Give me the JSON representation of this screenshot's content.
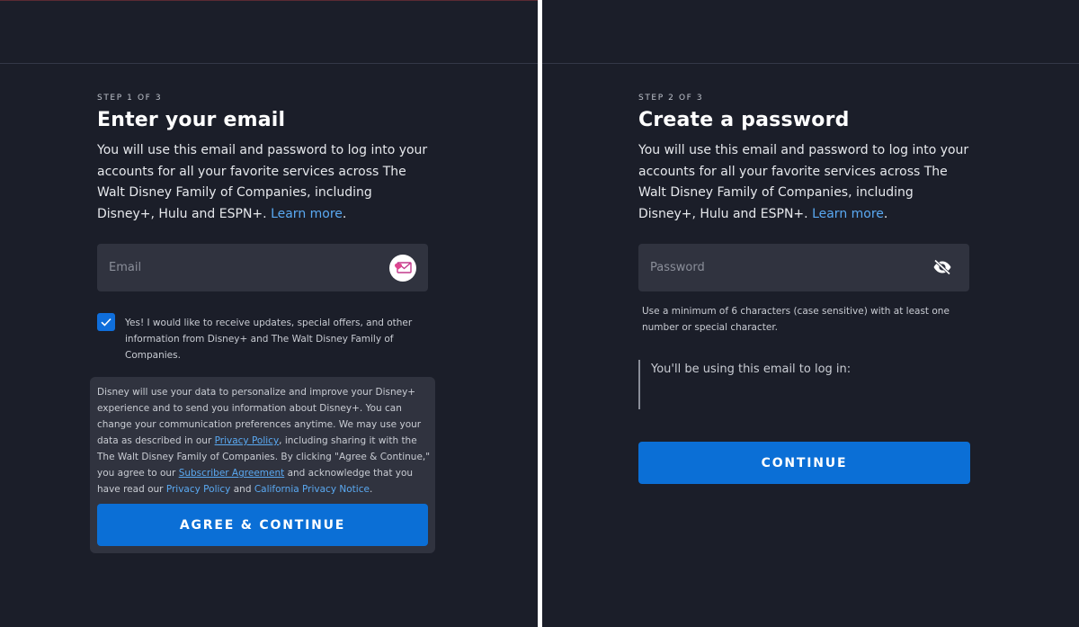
{
  "step1": {
    "step_label": "STEP 1 OF 3",
    "title": "Enter your email",
    "description": "You will use this email and password to log into your accounts for all your favorite services across The Walt Disney Family of Companies, including Disney+, Hulu and ESPN+.",
    "learn_more": "Learn more",
    "learn_more_suffix": ".",
    "email_placeholder": "Email",
    "email_value": "",
    "checkbox_checked": true,
    "checkbox_label": "Yes! I would like to receive updates, special offers, and other information from Disney+ and The Walt Disney Family of Companies.",
    "consent": {
      "part1": "Disney will use your data to personalize and improve your Disney+ experience and to send you information about Disney+. You can change your communication preferences anytime. We may use your data as described in our ",
      "privacy_policy_link": "Privacy Policy",
      "part2": ", including sharing it with the The Walt Disney Family of Companies. By clicking \"Agree & Continue,\" you agree to our ",
      "subscriber_agreement_link": "Subscriber Agreement",
      "part3": " and acknowledge that you have read our ",
      "privacy_policy_link2": "Privacy Policy",
      "part4": " and ",
      "california_link": "California Privacy Notice",
      "part5": "."
    },
    "button_label": "AGREE & CONTINUE"
  },
  "step2": {
    "step_label": "STEP 2 OF 3",
    "title": "Create a password",
    "description": "You will use this email and password to log into your accounts for all your favorite services across The Walt Disney Family of Companies, including Disney+, Hulu and ESPN+.",
    "learn_more": "Learn more",
    "learn_more_suffix": ".",
    "password_placeholder": "Password",
    "password_hint": "Use a minimum of 6 characters (case sensitive) with at least one number or special character.",
    "email_note": "You'll be using this email to log in:",
    "button_label": "CONTINUE"
  },
  "icons": {
    "email": "mail-heart-icon",
    "password_toggle": "eye-slash-icon",
    "checkbox": "checkmark-icon"
  },
  "colors": {
    "background": "#1b1e29",
    "input": "#30333f",
    "primary_button": "#0b6fd6",
    "link": "#5aa9f2"
  }
}
